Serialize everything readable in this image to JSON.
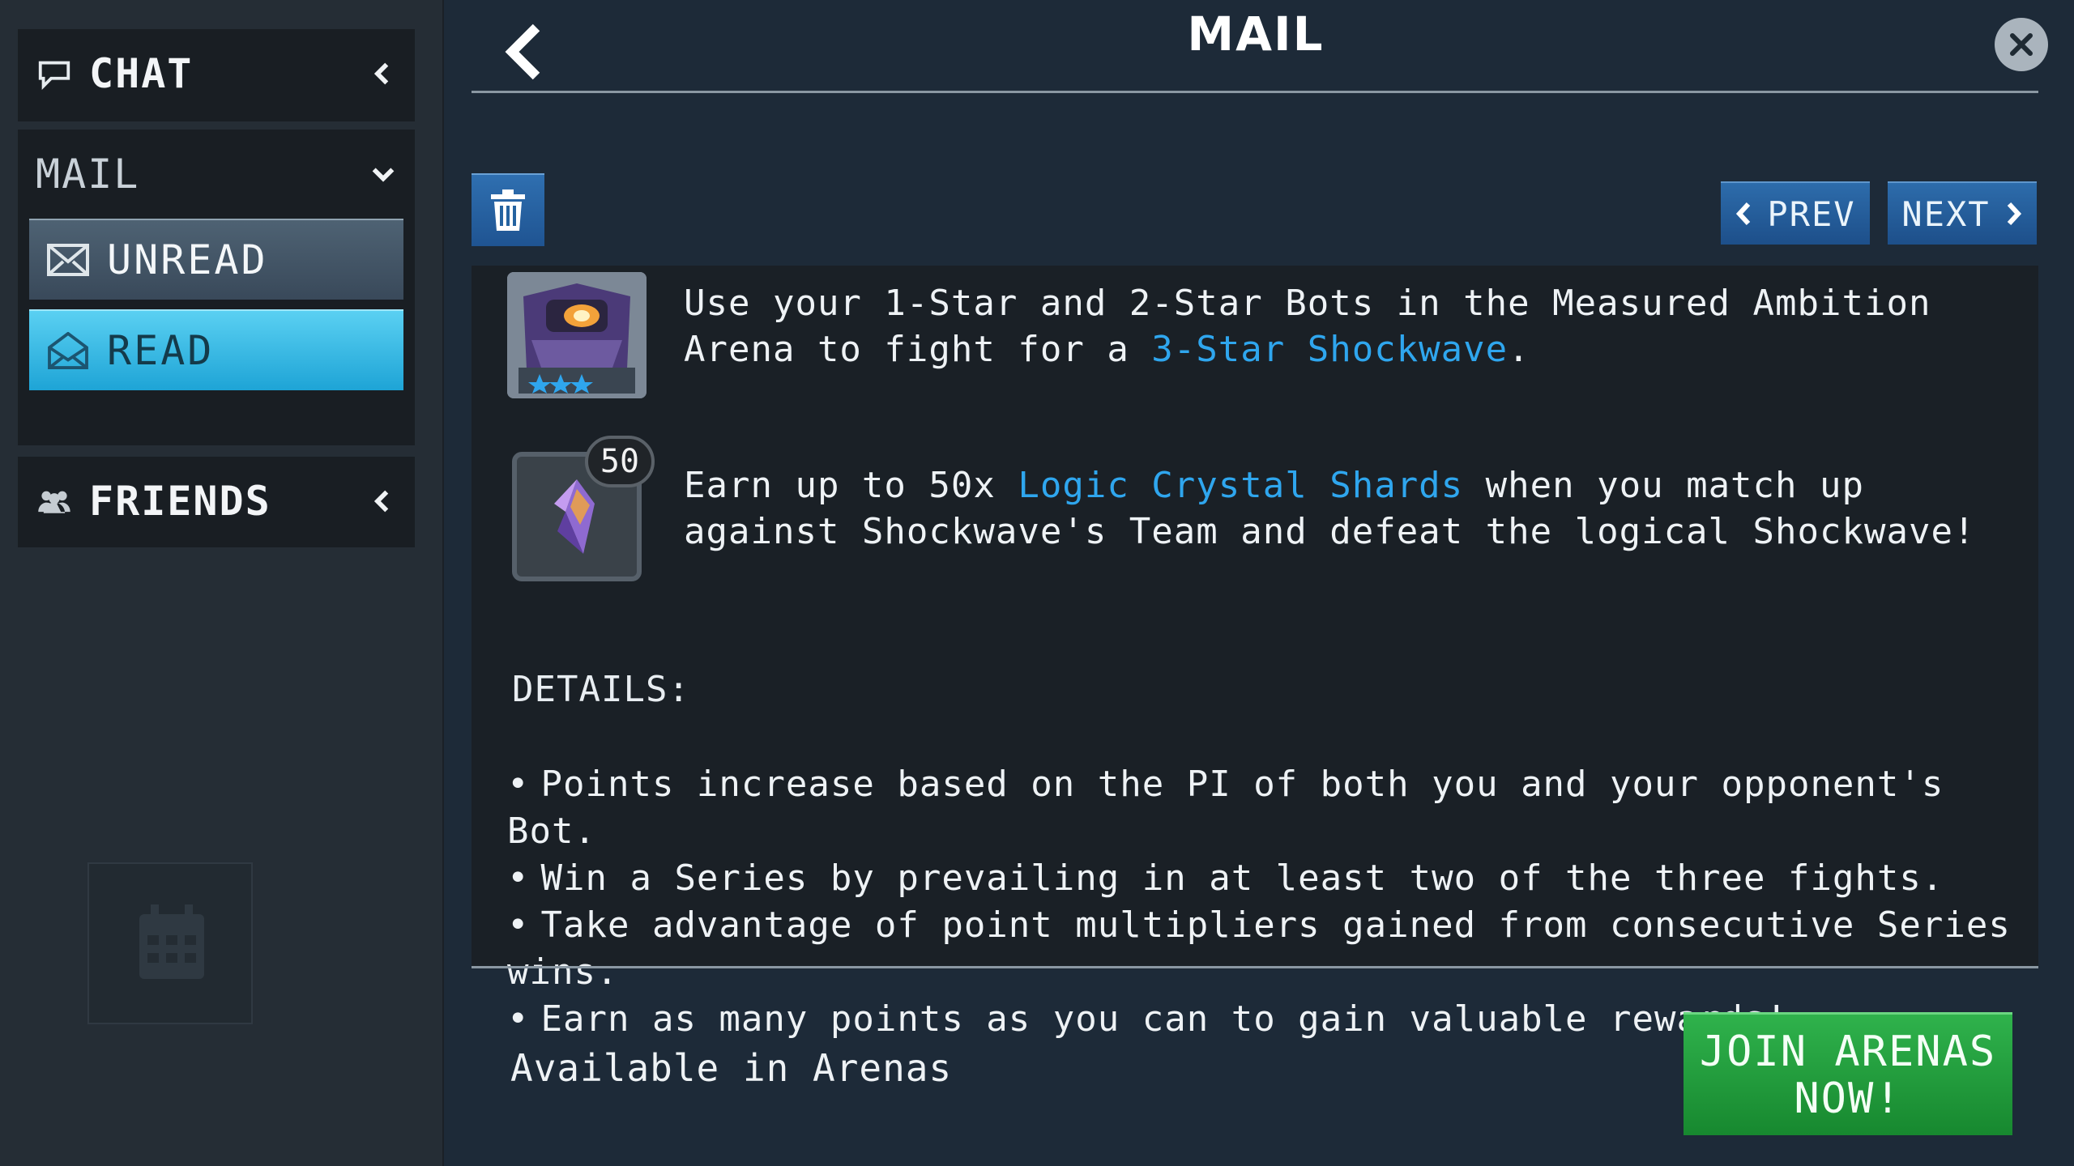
{
  "sidebar": {
    "chat": {
      "label": "CHAT",
      "icon": "megaphone-icon",
      "chevron": "chevron-left-icon"
    },
    "mail": {
      "label": "MAIL",
      "chevron": "chevron-down-icon",
      "items": [
        {
          "label": "UNREAD",
          "icon": "envelope-closed-icon",
          "selected": false
        },
        {
          "label": "READ",
          "icon": "envelope-open-icon",
          "selected": true
        }
      ]
    },
    "friends": {
      "label": "FRIENDS",
      "icon": "people-icon",
      "chevron": "chevron-left-icon"
    }
  },
  "header": {
    "title": "MAIL",
    "back_icon": "back-chevron-icon",
    "close_icon": "close-icon"
  },
  "toolbar": {
    "delete_icon": "trash-icon",
    "prev_label": "PREV",
    "next_label": "NEXT"
  },
  "message": {
    "paragraph1": {
      "text_before": "Use your 1-Star and 2-Star Bots in the Measured Ambition Arena to fight for a ",
      "link": "3-Star Shockwave",
      "text_after": "."
    },
    "reward": {
      "badge": "50",
      "text_before": "Earn up to 50x ",
      "link": "Logic Crystal Shards",
      "text_after": " when you match up against Shockwave's Team and defeat the logical Shockwave!"
    },
    "details_title": "DETAILS:",
    "bullets": [
      "Points increase based on the PI of both you and your opponent's Bot.",
      "Win a Series by prevailing in at least two of the three fights.",
      "Take advantage of point multipliers gained from consecutive Series wins.",
      "Earn as many points as you can to gain valuable rewards!"
    ]
  },
  "footer": {
    "availability": "Available in Arenas",
    "join_button": "JOIN ARENAS\nNOW!"
  },
  "colors": {
    "link": "#2fa6ee",
    "read_selected": "#2cb6e4",
    "join_button": "#22a03f",
    "nav_button": "#2563a0"
  }
}
